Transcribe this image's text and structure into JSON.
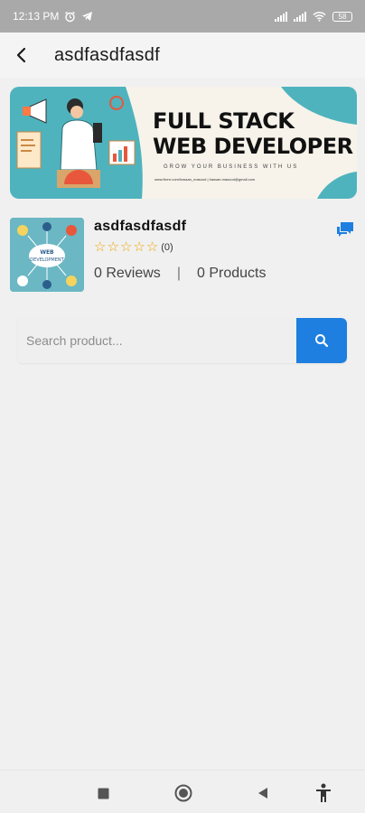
{
  "status_bar": {
    "time": "12:13 PM",
    "battery": "58",
    "icons": [
      "alarm-icon",
      "telegram-icon",
      "signal-icon",
      "signal-icon",
      "wifi-icon",
      "battery-icon"
    ]
  },
  "app_bar": {
    "title": "asdfasdfasdf",
    "back_icon": "arrow-back-icon"
  },
  "banner": {
    "title_line1": "FULL STACK",
    "title_line2": "WEB DEVELOPER",
    "subtitle": "GROW YOUR BUSINESS WITH US",
    "contact": "www.fiverr.com/hassan_masood | hassan.masood@gmail.com"
  },
  "store": {
    "name": "asdfasdfasdf",
    "rating_value": 0,
    "rating_max": 5,
    "rating_count": "(0)",
    "reviews": "0 Reviews",
    "separator": "|",
    "products": "0 Products",
    "logo_text": "WEB DEVELOPMENT",
    "chat_icon": "chat-icon"
  },
  "search": {
    "placeholder": "Search product...",
    "value": "",
    "button_icon": "search-icon"
  },
  "nav_bar": {
    "items": [
      "recents-square-icon",
      "home-circle-icon",
      "back-triangle-icon",
      "accessibility-icon"
    ]
  },
  "colors": {
    "accent": "#1e7fe0",
    "star": "#f0a500",
    "banner_teal": "#4fb3be"
  }
}
